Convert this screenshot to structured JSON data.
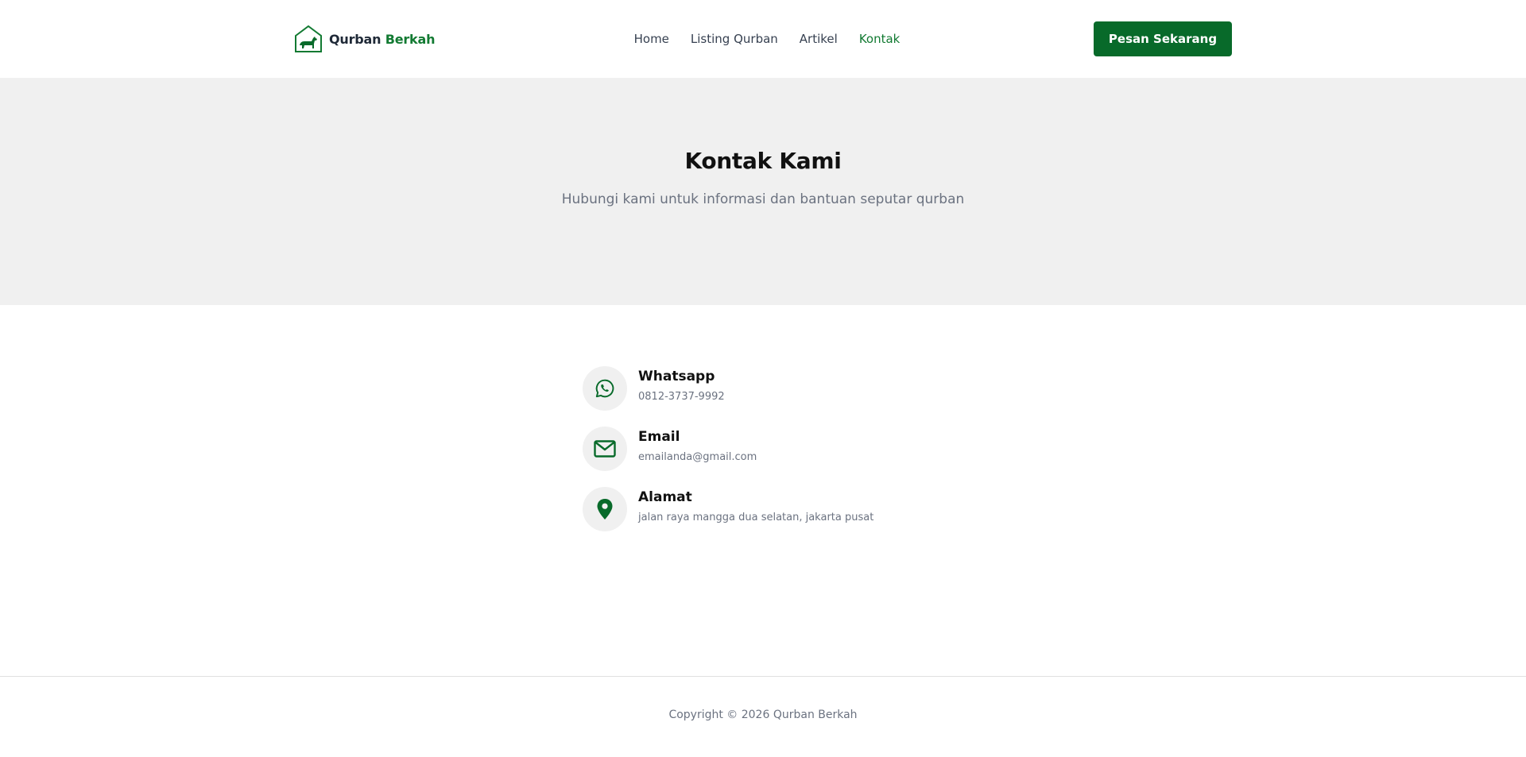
{
  "header": {
    "brand_primary": "Qurban",
    "brand_accent": "Berkah",
    "nav": [
      {
        "label": "Home",
        "active": false
      },
      {
        "label": "Listing Qurban",
        "active": false
      },
      {
        "label": "Artikel",
        "active": false
      },
      {
        "label": "Kontak",
        "active": true
      }
    ],
    "cta_label": "Pesan Sekarang"
  },
  "hero": {
    "title": "Kontak Kami",
    "subtitle": "Hubungi kami untuk informasi dan bantuan seputar qurban"
  },
  "contacts": [
    {
      "icon": "whatsapp-icon",
      "title": "Whatsapp",
      "value": "0812-3737-9992"
    },
    {
      "icon": "mail-icon",
      "title": "Email",
      "value": "emailanda@gmail.com"
    },
    {
      "icon": "map-pin-icon",
      "title": "Alamat",
      "value": "jalan raya mangga dua selatan, jakarta pusat"
    }
  ],
  "footer": {
    "copyright": "Copyright © 2026 Qurban Berkah"
  },
  "colors": {
    "brand_green": "#086a2a",
    "accent_green": "#127a32",
    "hero_bg": "#f0f0f0"
  }
}
